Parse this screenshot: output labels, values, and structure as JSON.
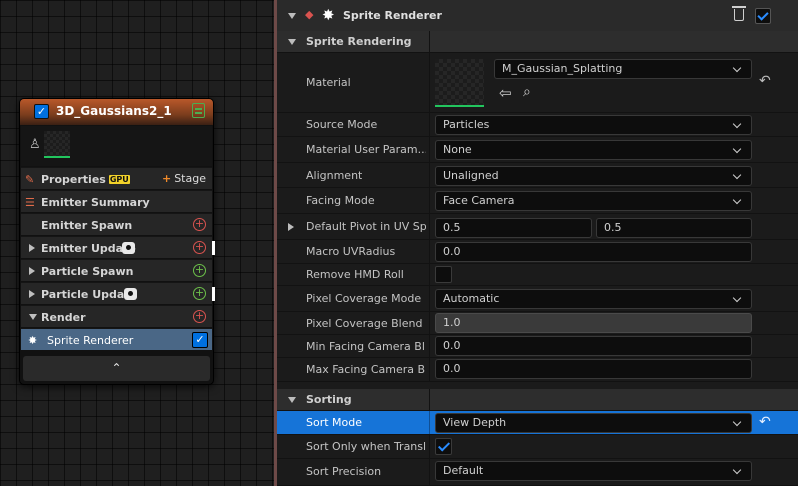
{
  "node": {
    "title": "3D_Gaussians2_1",
    "properties_label": "Properties",
    "gpu_badge": "GPU",
    "stage_label": "Stage",
    "emitter_summary": "Emitter Summary",
    "emitter_spawn": "Emitter Spawn",
    "emitter_update": "Emitter Update",
    "particle_spawn": "Particle Spawn",
    "particle_update": "Particle Update",
    "render": "Render",
    "sprite_renderer": "Sprite Renderer",
    "collapse_glyph": "⌃"
  },
  "panel": {
    "header_title": "Sprite Renderer",
    "sections": {
      "rendering": "Sprite Rendering",
      "sorting": "Sorting"
    },
    "props": {
      "material": {
        "label": "Material",
        "value": "M_Gaussian_Splatting"
      },
      "source_mode": {
        "label": "Source Mode",
        "value": "Particles"
      },
      "material_user_param": {
        "label": "Material User Param...",
        "value": "None"
      },
      "alignment": {
        "label": "Alignment",
        "value": "Unaligned"
      },
      "facing_mode": {
        "label": "Facing Mode",
        "value": "Face Camera"
      },
      "default_pivot": {
        "label": "Default Pivot in UV Sp...",
        "x": "0.5",
        "y": "0.5"
      },
      "macro_uv_radius": {
        "label": "Macro UVRadius",
        "value": "0.0"
      },
      "remove_hmd_roll": {
        "label": "Remove HMD Roll",
        "checked": false
      },
      "pixel_coverage_mode": {
        "label": "Pixel Coverage Mode",
        "value": "Automatic"
      },
      "pixel_coverage_blend": {
        "label": "Pixel Coverage Blend",
        "value": "1.0"
      },
      "min_facing_camera": {
        "label": "Min Facing Camera Bl...",
        "value": "0.0"
      },
      "max_facing_camera": {
        "label": "Max Facing Camera B...",
        "value": "0.0"
      },
      "sort_mode": {
        "label": "Sort Mode",
        "value": "View Depth"
      },
      "sort_only_translucent": {
        "label": "Sort Only when Transl...",
        "checked": true
      },
      "sort_precision": {
        "label": "Sort Precision",
        "value": "Default"
      }
    }
  },
  "colors": {
    "accent_blue": "#1674d8",
    "node_header": "#b9582a",
    "panel_border": "#6e4a48"
  }
}
